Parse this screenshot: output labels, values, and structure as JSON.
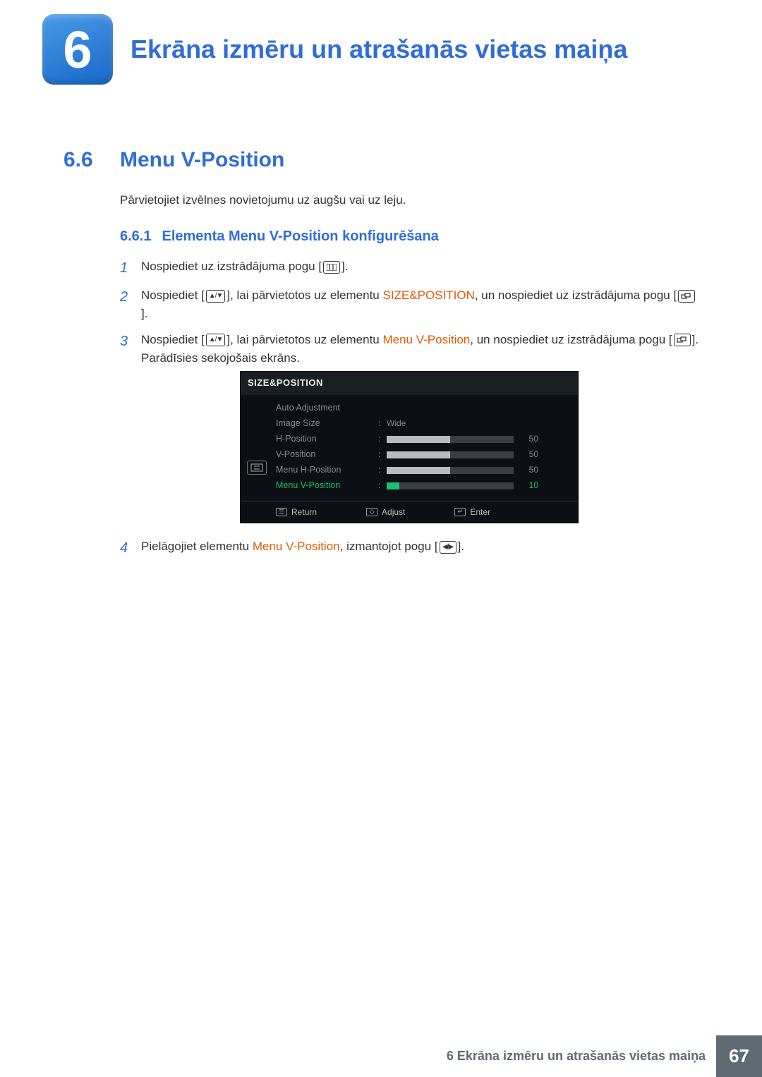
{
  "chapter": {
    "number": "6",
    "title": "Ekrāna izmēru un atrašanās vietas maiņa"
  },
  "section": {
    "number": "6.6",
    "title": "Menu V-Position"
  },
  "intro": "Pārvietojiet izvēlnes novietojumu uz augšu vai uz leju.",
  "subsection": {
    "number": "6.6.1",
    "title": "Elementa Menu V-Position konfigurēšana"
  },
  "steps": {
    "s1": {
      "n": "1",
      "a": "Nospiediet uz izstrādājuma pogu [",
      "b": "]."
    },
    "s2": {
      "n": "2",
      "a": "Nospiediet [",
      "b": "], lai pārvietotos uz elementu ",
      "hl": "SIZE&POSITION",
      "c": ", un nospiediet uz izstrādājuma pogu [",
      "d": "]."
    },
    "s3": {
      "n": "3",
      "a": "Nospiediet [",
      "b": "], lai pārvietotos uz elementu ",
      "hl": "Menu V-Position",
      "c": ", un nospiediet uz izstrādājuma pogu [",
      "d": "]. Parādīsies sekojošais ekrāns."
    },
    "s4": {
      "n": "4",
      "a": "Pielāgojiet elementu ",
      "hl": "Menu V-Position",
      "b": ", izmantojot pogu [",
      "c": "]."
    }
  },
  "osd": {
    "title": "SIZE&POSITION",
    "rows": {
      "auto": {
        "label": "Auto Adjustment"
      },
      "img": {
        "label": "Image Size",
        "value": "Wide"
      },
      "hpos": {
        "label": "H-Position",
        "value": "50",
        "fill": 50
      },
      "vpos": {
        "label": "V-Position",
        "value": "50",
        "fill": 50
      },
      "mhpos": {
        "label": "Menu H-Position",
        "value": "50",
        "fill": 50
      },
      "mvpos": {
        "label": "Menu V-Position",
        "value": "10",
        "fill": 10
      }
    },
    "footer": {
      "return": "Return",
      "adjust": "Adjust",
      "enter": "Enter"
    }
  },
  "footer": {
    "text": "6 Ekrāna izmēru un atrašanās vietas maiņa",
    "page": "67"
  }
}
